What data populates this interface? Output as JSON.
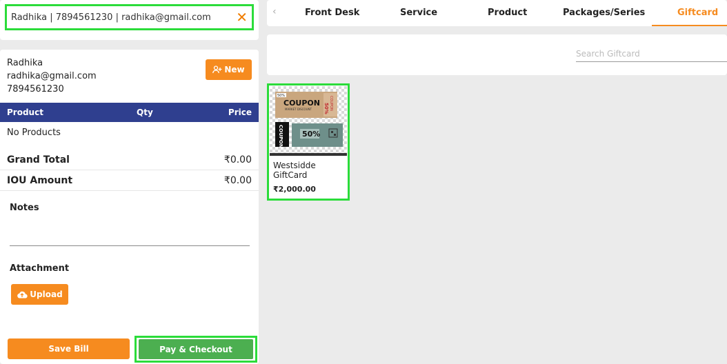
{
  "customer_search": {
    "value": "Radhika | 7894561230 | radhika@gmail.com",
    "clear_icon": "close-icon"
  },
  "customer": {
    "name": "Radhika",
    "email": "radhika@gmail.com",
    "phone": "7894561230",
    "new_label": "New",
    "new_icon": "add-user-icon"
  },
  "table": {
    "headers": [
      "Product",
      "Qty",
      "Price"
    ],
    "empty_text": "No Products"
  },
  "totals": {
    "grand_total_label": "Grand Total",
    "grand_total_value": "₹0.00",
    "iou_label": "IOU Amount",
    "iou_value": "₹0.00"
  },
  "notes": {
    "label": "Notes"
  },
  "attachment": {
    "label": "Attachment",
    "upload_label": "Upload",
    "upload_icon": "cloud-upload-icon"
  },
  "actions": {
    "save_label": "Save Bill",
    "pay_label": "Pay & Checkout"
  },
  "tabs": {
    "prev_icon": "chevron-left-icon",
    "items": [
      {
        "label": "Front Desk"
      },
      {
        "label": "Service"
      },
      {
        "label": "Product"
      },
      {
        "label": "Packages/Series"
      },
      {
        "label": "Giftcard"
      }
    ],
    "active": "Giftcard"
  },
  "giftcard_search": {
    "placeholder": "Search Giftcard"
  },
  "giftcards": [
    {
      "name": "Westsidde GiftCard",
      "price": "₹2,000.00",
      "image_text": {
        "coupon_1": "COUPON",
        "sub_1": "MARKET DISCOUNT",
        "pct_small": "50%",
        "side_1": "COUPON",
        "side_pct": "50%",
        "coupon_2": "COUPON",
        "pct_big": "50%"
      }
    }
  ],
  "colors": {
    "accent_orange": "#f68b1f",
    "header_blue": "#2f3f8f",
    "checkout_green": "#4caf50",
    "highlight_green": "#2bdc3a"
  }
}
